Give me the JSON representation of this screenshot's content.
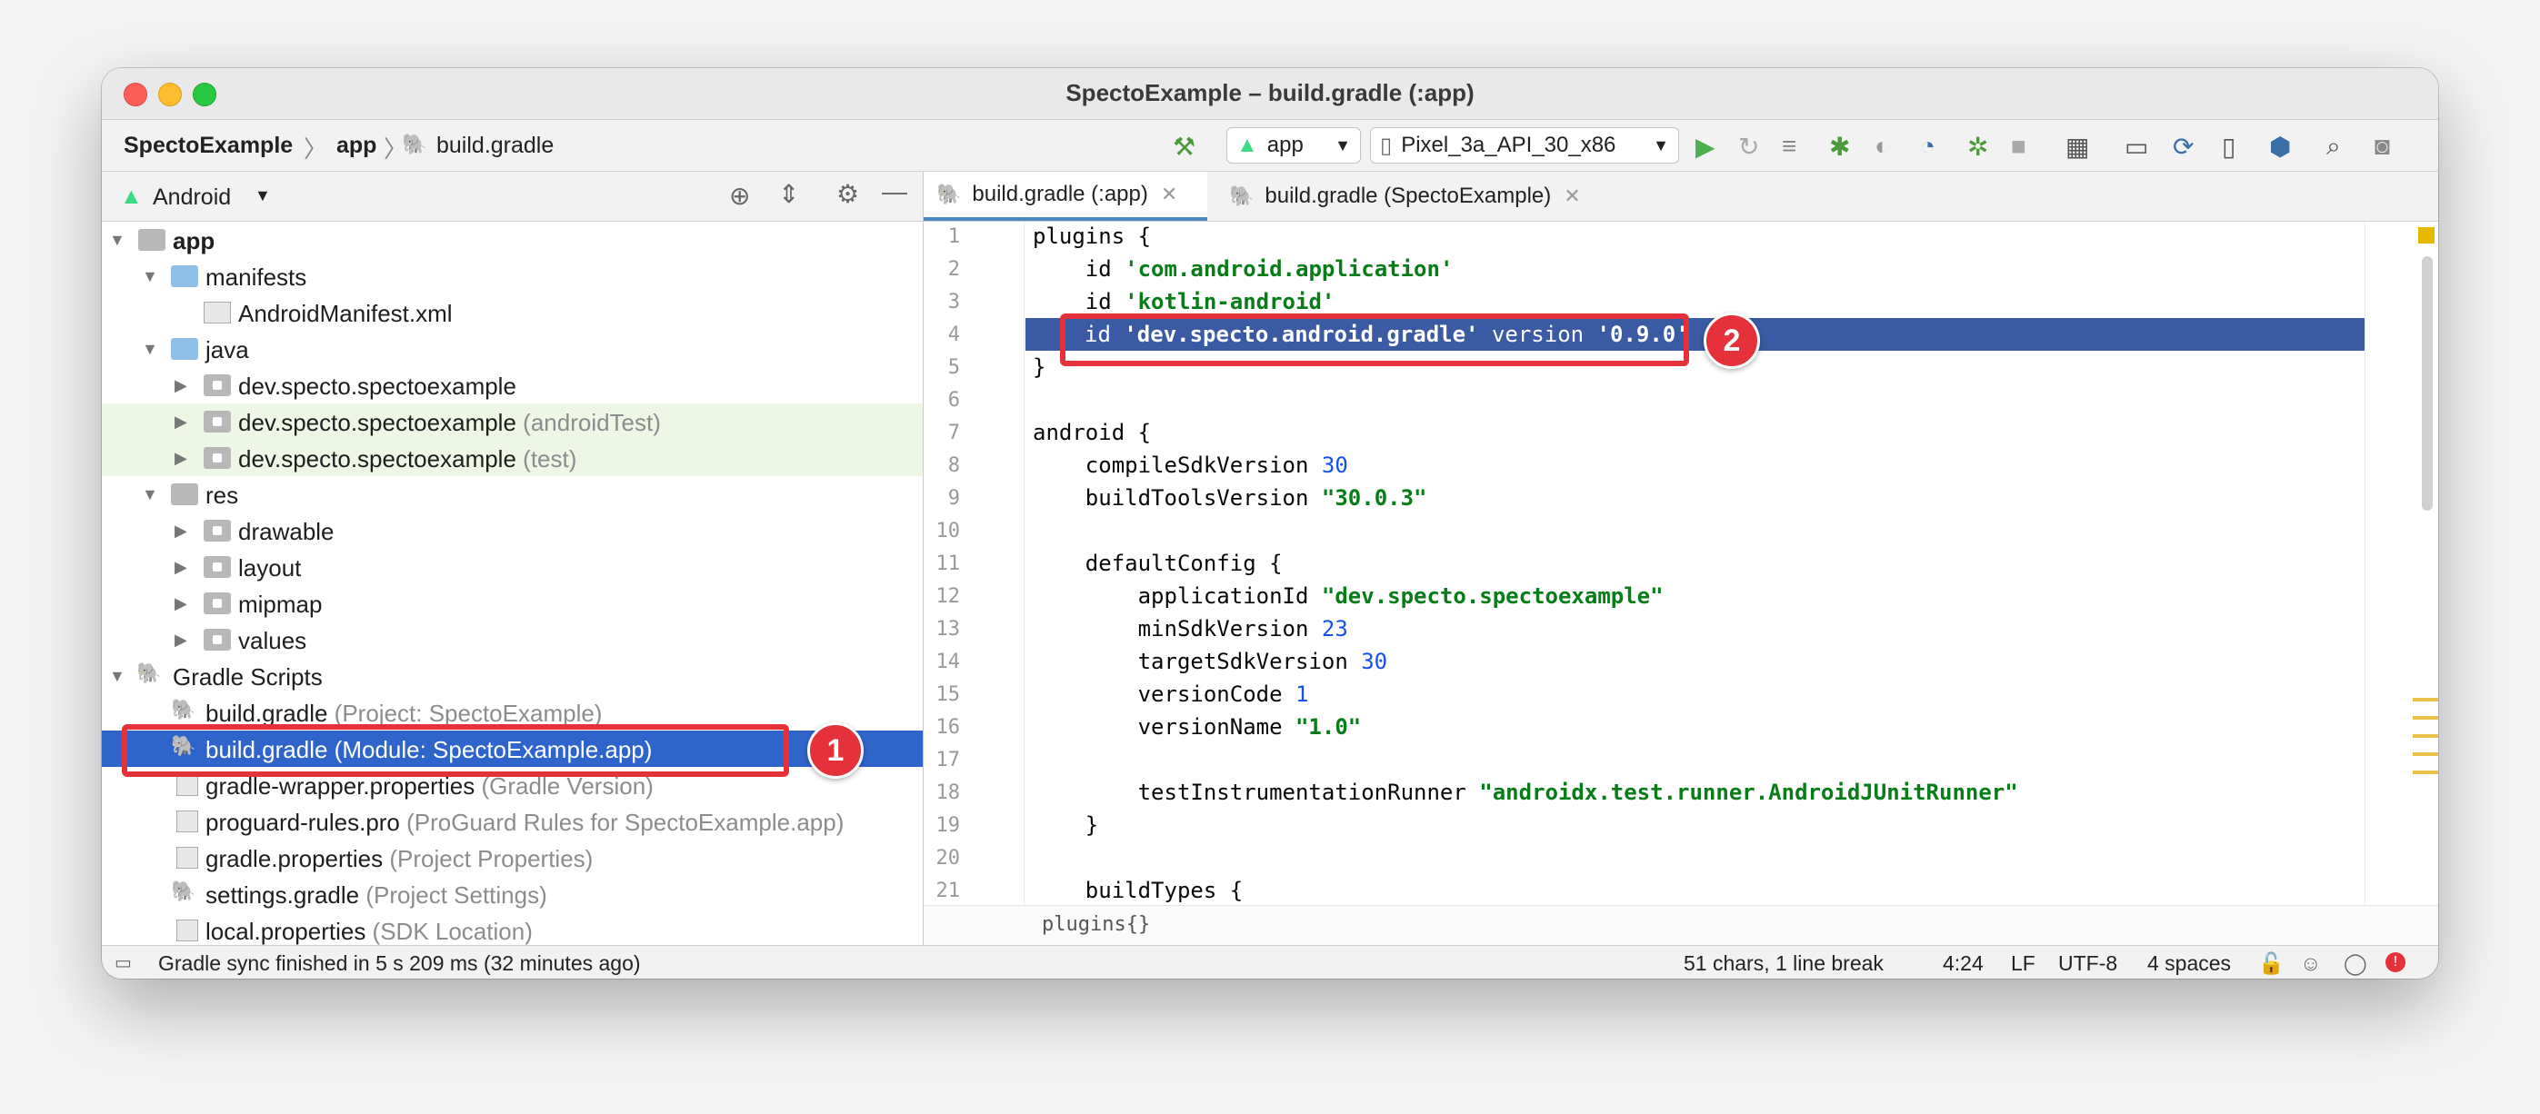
{
  "window": {
    "title": "SpectoExample – build.gradle (:app)"
  },
  "navbar": {
    "crumbs": [
      "SpectoExample",
      "app",
      "build.gradle"
    ],
    "config_combo": "app",
    "device_combo": "Pixel_3a_API_30_x86"
  },
  "project_panel": {
    "view_mode": "Android",
    "tree": [
      {
        "label": "app",
        "hint": "",
        "level": 0,
        "bold": true
      },
      {
        "label": "manifests",
        "hint": "",
        "level": 1
      },
      {
        "label": "AndroidManifest.xml",
        "hint": "",
        "level": 2
      },
      {
        "label": "java",
        "hint": "",
        "level": 1
      },
      {
        "label": "dev.specto.spectoexample",
        "hint": "",
        "level": 2
      },
      {
        "label": "dev.specto.spectoexample",
        "hint": "(androidTest)",
        "level": 2
      },
      {
        "label": "dev.specto.spectoexample",
        "hint": "(test)",
        "level": 2
      },
      {
        "label": "res",
        "hint": "",
        "level": 1
      },
      {
        "label": "drawable",
        "hint": "",
        "level": 2
      },
      {
        "label": "layout",
        "hint": "",
        "level": 2
      },
      {
        "label": "mipmap",
        "hint": "",
        "level": 2
      },
      {
        "label": "values",
        "hint": "",
        "level": 2
      },
      {
        "label": "Gradle Scripts",
        "hint": "",
        "level": 0
      },
      {
        "label": "build.gradle",
        "hint": "(Project: SpectoExample)",
        "level": 1
      },
      {
        "label": "build.gradle",
        "hint": "(Module: SpectoExample.app)",
        "level": 1
      },
      {
        "label": "gradle-wrapper.properties",
        "hint": "(Gradle Version)",
        "level": 1
      },
      {
        "label": "proguard-rules.pro",
        "hint": "(ProGuard Rules for SpectoExample.app)",
        "level": 1
      },
      {
        "label": "gradle.properties",
        "hint": "(Project Properties)",
        "level": 1
      },
      {
        "label": "settings.gradle",
        "hint": "(Project Settings)",
        "level": 1
      },
      {
        "label": "local.properties",
        "hint": "(SDK Location)",
        "level": 1
      }
    ]
  },
  "editor": {
    "tabs": [
      "build.gradle (:app)",
      "build.gradle (SpectoExample)"
    ],
    "line_numbers": [
      "1",
      "2",
      "3",
      "4",
      "5",
      "6",
      "7",
      "8",
      "9",
      "10",
      "11",
      "12",
      "13",
      "14",
      "15",
      "16",
      "17",
      "18",
      "19",
      "20",
      "21"
    ],
    "code": {
      "l1": "plugins {",
      "l2_kw": "    id ",
      "l2_str": "'com.android.application'",
      "l3_kw": "    id ",
      "l3_str": "'kotlin-android'",
      "l4_kw": "id ",
      "l4_str": "'dev.specto.android.gradle'",
      "l4_mid": " version ",
      "l4_ver": "'0.9.0'",
      "l5": "}",
      "l7": "android {",
      "l8_kw": "    compileSdkVersion ",
      "l8_num": "30",
      "l9_kw": "    buildToolsVersion ",
      "l9_str": "\"30.0.3\"",
      "l11": "    defaultConfig {",
      "l12_kw": "        applicationId ",
      "l12_str": "\"dev.specto.spectoexample\"",
      "l13_kw": "        minSdkVersion ",
      "l13_num": "23",
      "l14_kw": "        targetSdkVersion ",
      "l14_num": "30",
      "l15_kw": "        versionCode ",
      "l15_num": "1",
      "l16_kw": "        versionName ",
      "l16_str": "\"1.0\"",
      "l18_kw": "        testInstrumentationRunner ",
      "l18_str": "\"androidx.test.runner.AndroidJUnitRunner\"",
      "l19": "    }",
      "l21": "    buildTypes {"
    },
    "breadcrumb": "plugins{}"
  },
  "statusbar": {
    "message": "Gradle sync finished in 5 s 209 ms (32 minutes ago)",
    "selection": "51 chars, 1 line break",
    "position": "4:24",
    "line_sep": "LF",
    "encoding": "UTF-8",
    "indent": "4 spaces"
  },
  "callouts": [
    "1",
    "2"
  ]
}
